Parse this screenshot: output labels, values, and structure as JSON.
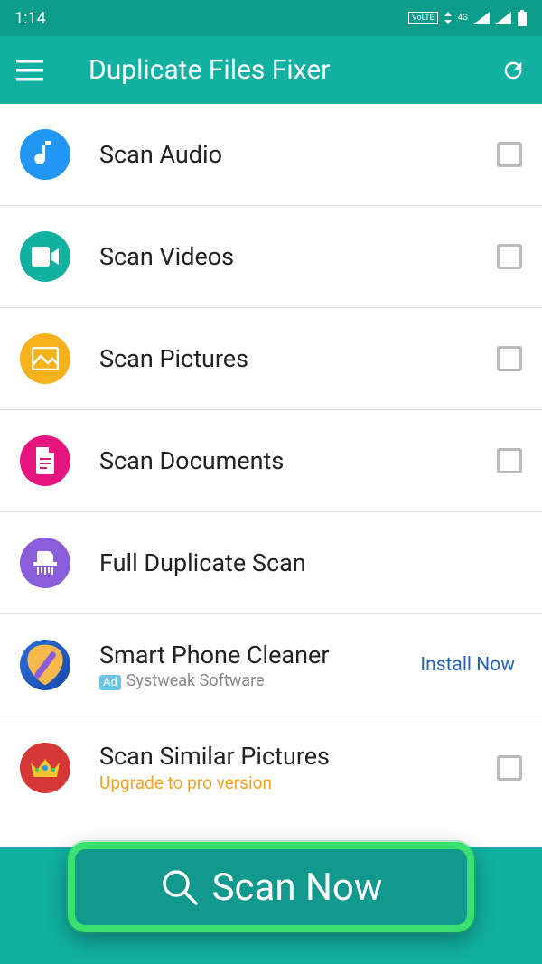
{
  "status": {
    "time": "1:14",
    "volte": "VoLTE",
    "network": "4G"
  },
  "appbar": {
    "title": "Duplicate Files Fixer"
  },
  "items": [
    {
      "label": "Scan Audio"
    },
    {
      "label": "Scan Videos"
    },
    {
      "label": "Scan Pictures"
    },
    {
      "label": "Scan Documents"
    },
    {
      "label": "Full Duplicate Scan"
    }
  ],
  "ad": {
    "title": "Smart Phone Cleaner",
    "badge": "Ad",
    "subtitle": "Systweak Software",
    "cta": "Install Now"
  },
  "pro": {
    "title": "Scan Similar Pictures",
    "subtitle": "Upgrade to pro version"
  },
  "button": {
    "label": "Scan Now"
  }
}
